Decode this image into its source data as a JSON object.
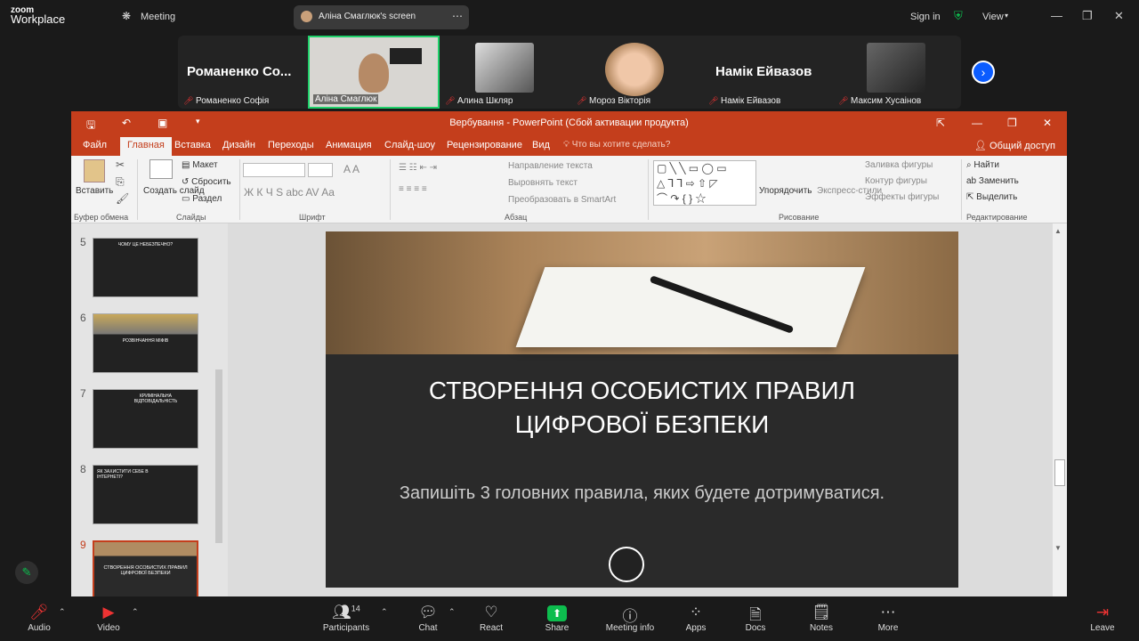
{
  "zoom": {
    "brand": "zoom",
    "product": "Workplace",
    "meeting_label": "Meeting",
    "share_label": "Аліна Смаглюк's screen",
    "signin": "Sign in",
    "view": "View"
  },
  "gallery": {
    "tiles": [
      {
        "big": "Романенко Со...",
        "name": "Романенко Софія"
      },
      {
        "name": "Аліна Смаглюк"
      },
      {
        "name": "Алина Шкляр"
      },
      {
        "name": "Мороз Вікторія"
      },
      {
        "big": "Намік Ейвазов",
        "name": "Намік Ейвазов"
      },
      {
        "name": "Максим Хусаінов"
      }
    ]
  },
  "ppt": {
    "title": "Вербування - PowerPoint (Сбой активации продукта)",
    "tabs": [
      "Файл",
      "Главная",
      "Вставка",
      "Дизайн",
      "Переходы",
      "Анимация",
      "Слайд-шоу",
      "Рецензирование",
      "Вид"
    ],
    "tell_me": "Что вы хотите сделать?",
    "share": "Общий доступ",
    "ribbon": {
      "paste": "Вставить",
      "new_slide": "Создать слайд",
      "layout": "Макет",
      "reset": "Сбросить",
      "section": "Раздел",
      "text_dir": "Направление текста",
      "align_text": "Выровнять текст",
      "smartart": "Преобразовать в SmartArt",
      "arrange": "Упорядочить",
      "quick_styles": "Экспресс-стили",
      "fill": "Заливка фигуры",
      "outline": "Контур фигуры",
      "effects": "Эффекты фигуры",
      "find": "Найти",
      "replace": "Заменить",
      "select": "Выделить",
      "groups": [
        "Буфер обмена",
        "Слайды",
        "Шрифт",
        "Абзац",
        "Рисование",
        "Редактирование"
      ]
    },
    "slides": [
      {
        "num": "5",
        "text": "ЧОМУ ЦЕ НЕБЕЗПЕЧНО?"
      },
      {
        "num": "6",
        "text": "РОЗВІНЧАННЯ МІФІВ"
      },
      {
        "num": "7",
        "text": "КРИМІНАЛЬНА ВІДПОВІДАЛЬНІСТЬ"
      },
      {
        "num": "8",
        "text": "ЯК ЗАХИСТИТИ СЕБЕ В ІНТЕРНЕТІ?"
      },
      {
        "num": "9",
        "text": "СТВОРЕННЯ ОСОБИСТИХ ПРАВИЛ ЦИФРОВОЇ БЕЗПЕКИ"
      }
    ],
    "current_slide": {
      "title_line1": "СТВОРЕННЯ ОСОБИСТИХ ПРАВИЛ",
      "title_line2": "ЦИФРОВОЇ БЕЗПЕКИ",
      "subtitle": "Запишіть 3 головних правила, яких будете дотримуватися."
    }
  },
  "toolbar": {
    "audio": "Audio",
    "video": "Video",
    "participants": "Participants",
    "participants_count": "14",
    "chat": "Chat",
    "react": "React",
    "share": "Share",
    "info": "Meeting info",
    "apps": "Apps",
    "docs": "Docs",
    "notes": "Notes",
    "more": "More",
    "leave": "Leave"
  },
  "colors": {
    "ppt_accent": "#c43e1c",
    "share_green": "#0dbd4e",
    "zoom_blue": "#0b5cff"
  }
}
